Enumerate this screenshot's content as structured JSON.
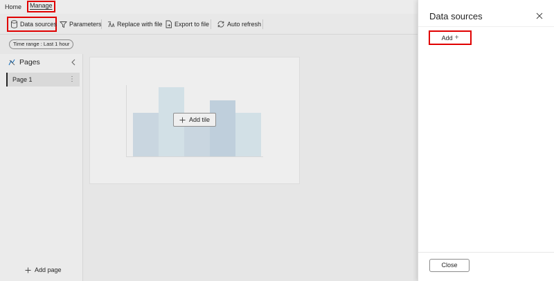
{
  "menu": {
    "home": "Home",
    "manage": "Manage"
  },
  "toolbar": {
    "data_sources": "Data sources",
    "parameters": "Parameters",
    "replace_with_file": "Replace with file",
    "export_to_file": "Export to file",
    "auto_refresh": "Auto refresh"
  },
  "filters": {
    "time_range": "Time range : Last 1 hour"
  },
  "pages_panel": {
    "title": "Pages",
    "pages": [
      {
        "label": "Page 1",
        "selected": true
      }
    ],
    "more_glyph": "⋮",
    "add_page": "Add page"
  },
  "canvas": {
    "add_tile": "Add tile",
    "placeholder_chart": {
      "bar_levels": [
        0.62,
        0.98,
        0.62,
        0.79,
        0.62
      ],
      "colors": [
        "#c9d6e0",
        "#d2e0e6",
        "#c9d6e0",
        "#bfcfdc",
        "#d2e0e6"
      ]
    }
  },
  "drawer": {
    "title": "Data sources",
    "add_label": "Add",
    "add_icon": "+",
    "close_label": "Close"
  },
  "colors": {
    "highlight": "#e00000",
    "accent": "#0f6cbd"
  }
}
